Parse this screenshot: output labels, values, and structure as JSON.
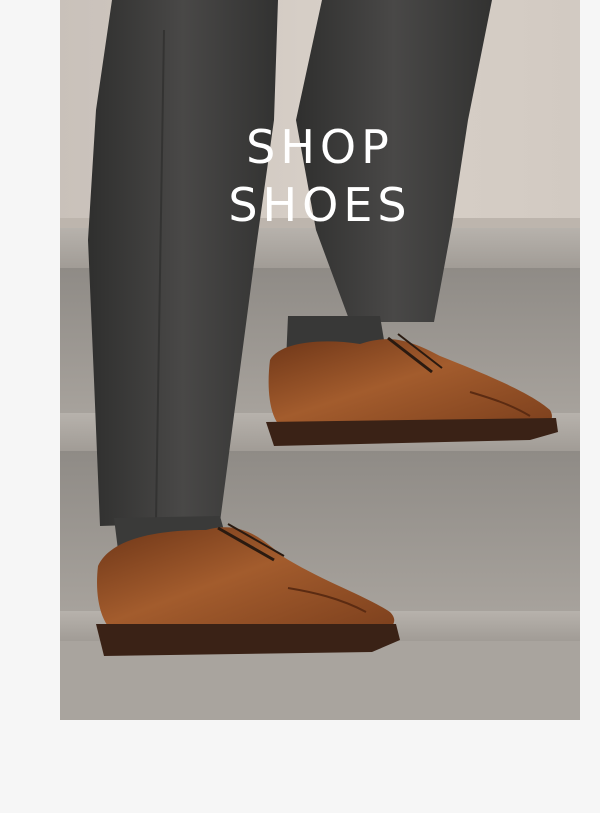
{
  "hero": {
    "title_line_1": "SHOP",
    "title_line_2": "SHOES",
    "image_alt": "shoes",
    "colors": {
      "wall": "#cfc7bf",
      "step": "#a8a49f",
      "trousers": "#3b3b3a",
      "leather": "#8a4a24",
      "sole": "#3a2216",
      "background": "#f6f6f6"
    }
  }
}
